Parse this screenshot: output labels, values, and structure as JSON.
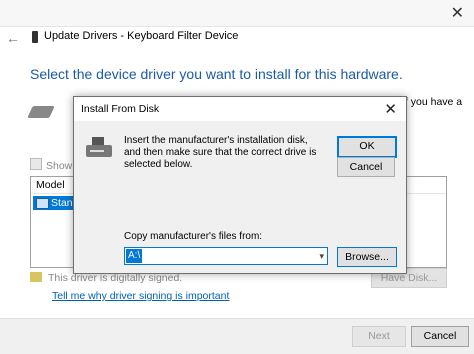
{
  "wizard": {
    "title": "Update Drivers - Keyboard Filter Device",
    "heading": "Select the device driver you want to install for this hardware.",
    "right_text_fragment": "If you have a",
    "show_compatible_label": "Show co",
    "model_header": "Model",
    "model_selected": "Standa",
    "signed_text": "This driver is digitally signed.",
    "signing_link": "Tell me why driver signing is important",
    "have_disk_label": "Have Disk...",
    "next_label": "Next",
    "cancel_label": "Cancel"
  },
  "dialog": {
    "title": "Install From Disk",
    "message": "Insert the manufacturer's installation disk, and then make sure that the correct drive is selected below.",
    "ok_label": "OK",
    "cancel_label": "Cancel",
    "copy_label": "Copy manufacturer's files from:",
    "path_value": "A:\\",
    "browse_label": "Browse..."
  },
  "colors": {
    "accent": "#0078d7",
    "heading": "#1b5ba6",
    "link": "#0063b1"
  },
  "icons": [
    "close-icon",
    "back-arrow-icon",
    "device-icon",
    "hardware-icon",
    "disk-drive-icon",
    "chevron-down-icon",
    "certificate-icon"
  ]
}
